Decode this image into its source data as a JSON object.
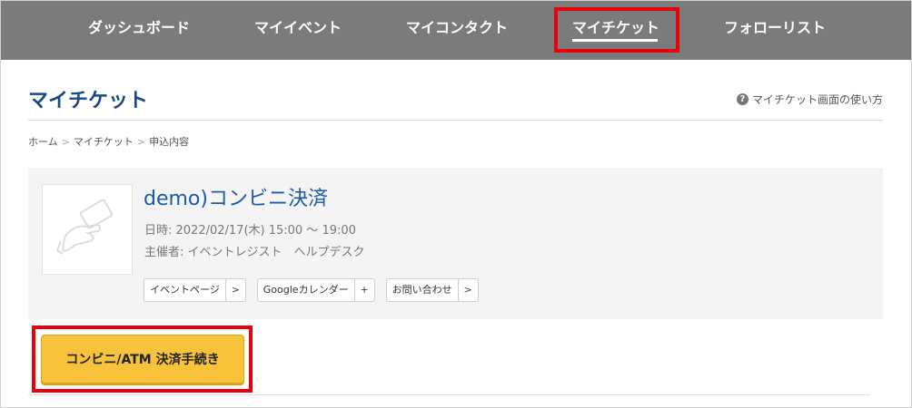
{
  "nav": {
    "items": [
      {
        "label": "ダッシュボード"
      },
      {
        "label": "マイイベント"
      },
      {
        "label": "マイコンタクト"
      },
      {
        "label": "マイチケット"
      },
      {
        "label": "フォローリスト"
      }
    ],
    "active_index": 3
  },
  "header": {
    "title": "マイチケット",
    "help_label": "マイチケット画面の使い方"
  },
  "breadcrumb": {
    "items": [
      "ホーム",
      "マイチケット",
      "申込内容"
    ],
    "separator": ">"
  },
  "event": {
    "title": "demo)コンビニ決済",
    "date": "日時: 2022/02/17(木) 15:00 〜 19:00",
    "host": "主催者: イベントレジスト　ヘルプデスク",
    "buttons": [
      {
        "label": "イベントページ",
        "icon": ">"
      },
      {
        "label": "Googleカレンダー",
        "icon": "+"
      },
      {
        "label": "お問い合わせ",
        "icon": ">"
      }
    ]
  },
  "payment": {
    "button_label": "コンビニ/ATM 決済手続き"
  },
  "colors": {
    "nav_bg": "#7b7b7b",
    "highlight": "#e8000b",
    "title": "#1a4a86",
    "event_title": "#1a5aa6",
    "pay_button": "#f8c33a"
  }
}
